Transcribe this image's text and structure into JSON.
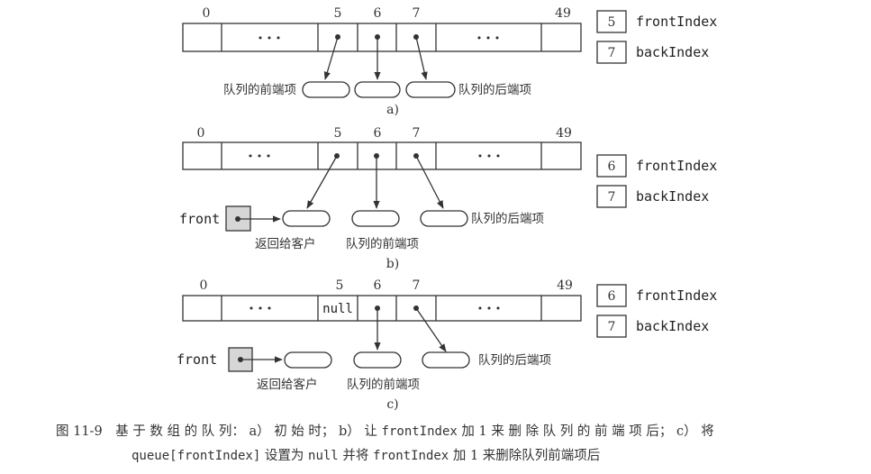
{
  "index_labels": {
    "first": "0",
    "i5": "5",
    "i6": "6",
    "i7": "7",
    "last": "49"
  },
  "ellipsis": "• • •",
  "null_text": "null",
  "front_var": "front",
  "front_index_label": "frontIndex",
  "back_index_label": "backIndex",
  "panels": [
    {
      "label": "a)",
      "front_index": "5",
      "back_index": "7",
      "left_note": "队列的前端项",
      "right_note": "队列的后端项"
    },
    {
      "label": "b)",
      "front_index": "6",
      "back_index": "7",
      "returned_note": "返回给客户",
      "front_note": "队列的前端项",
      "right_note": "队列的后端项"
    },
    {
      "label": "c)",
      "front_index": "6",
      "back_index": "7",
      "returned_note": "返回给客户",
      "front_note": "队列的前端项",
      "right_note": "队列的后端项"
    }
  ],
  "caption": {
    "line1_a": "图 11-9　基 于 数 组 的 队 列： a） 初 始 时； b） 让 ",
    "line1_code": "frontIndex",
    "line1_b": " 加 1 来 删 除 队 列 的 前 端 项 后； c） 将",
    "line2_code1": "queue[frontIndex]",
    "line2_a": " 设置为 ",
    "line2_code2": "null",
    "line2_b": " 并将 ",
    "line2_code3": "frontIndex",
    "line2_c": " 加 1 来删除队列前端项后"
  }
}
